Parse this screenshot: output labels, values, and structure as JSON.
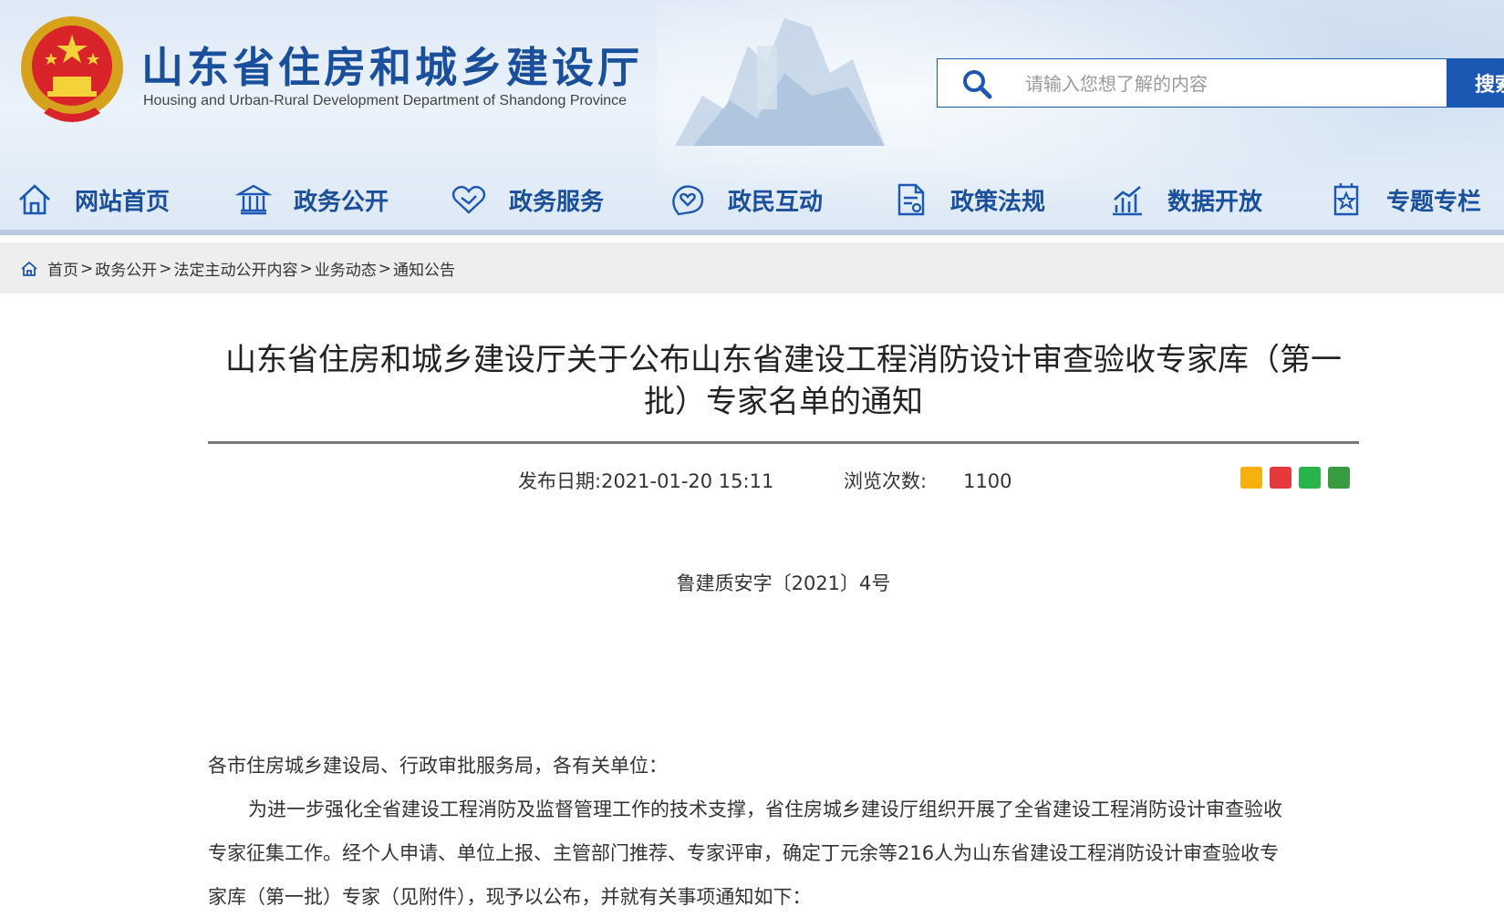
{
  "header": {
    "site_title": "山东省住房和城乡建设厅",
    "site_subtitle": "Housing and Urban-Rural Development Department of Shandong Province",
    "search": {
      "placeholder": "请输入您想了解的内容",
      "button_label": "搜索"
    }
  },
  "nav": {
    "items": [
      {
        "label": "网站首页",
        "icon": "home-icon"
      },
      {
        "label": "政务公开",
        "icon": "building-icon"
      },
      {
        "label": "政务服务",
        "icon": "handshake-icon"
      },
      {
        "label": "政民互动",
        "icon": "chat-heart-icon"
      },
      {
        "label": "政策法规",
        "icon": "document-icon"
      },
      {
        "label": "数据开放",
        "icon": "chart-icon"
      },
      {
        "label": "专题专栏",
        "icon": "bookmark-icon"
      }
    ]
  },
  "breadcrumb": {
    "items": [
      "首页",
      "政务公开",
      "法定主动公开内容",
      "业务动态",
      "通知公告"
    ],
    "separator": ">"
  },
  "article": {
    "title": "山东省住房和城乡建设厅关于公布山东省建设工程消防设计审查验收专家库（第一批）专家名单的通知",
    "publish_label": "发布日期:",
    "publish_date": "2021-01-20 15:11",
    "views_label": "浏览次数:",
    "views": "1100",
    "doc_number": "鲁建质安字〔2021〕4号",
    "salutation": "各市住房城乡建设局、行政审批服务局，各有关单位：",
    "body_line1": "为进一步强化全省建设工程消防及监督管理工作的技术支撑，省住房城乡建设厅组织开展了全省建设工程消防设计审查验收",
    "body_line2": "专家征集工作。经个人申请、单位上报、主管部门推荐、专家评审，确定丁元余等216人为山东省建设工程消防设计审查验收专",
    "body_line3": "家库（第一批）专家（见附件），现予以公布，并就有关事项通知如下："
  },
  "share_icons": [
    "qzone-icon",
    "weibo-icon",
    "wechat-icon",
    "douban-icon"
  ],
  "colors": {
    "brand_blue": "#1a4f9c",
    "button_blue": "#1a58b3"
  }
}
